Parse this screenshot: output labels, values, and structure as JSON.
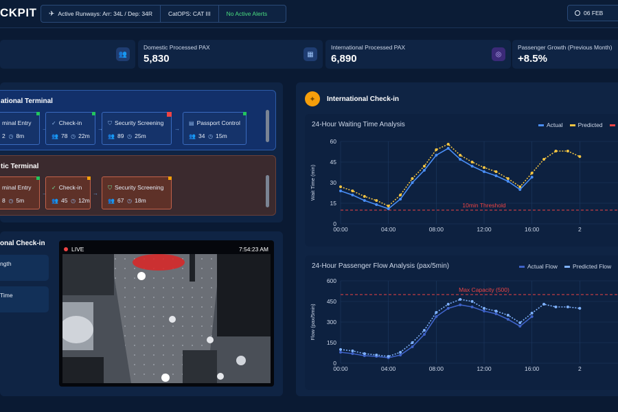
{
  "header": {
    "brand": "CKPIT",
    "runways": "Active Runways: Arr: 34L / Dep: 34R",
    "catops": "CatOPS: CAT III",
    "alerts": "No Active Alerts",
    "date": "06 FEB"
  },
  "kpis": [
    {
      "label": "Domestic Processed PAX",
      "value": "5,830",
      "icon": "users-icon"
    },
    {
      "label": "International Processed PAX",
      "value": "6,890",
      "icon": "map-icon"
    },
    {
      "label": "Passenger Growth (Previous Month)",
      "value": "+8.5%",
      "icon": "globe-icon"
    }
  ],
  "terminals": {
    "international": {
      "title": "ational Terminal",
      "stages": [
        {
          "name": "minal Entry",
          "count": "2",
          "time": "8m",
          "status": "#22c55e"
        },
        {
          "name": "Check-in",
          "count": "78",
          "time": "22m",
          "status": "#22c55e"
        },
        {
          "name": "Security Screening",
          "count": "89",
          "time": "25m",
          "status": "#ef4444"
        },
        {
          "name": "Passport Control",
          "count": "34",
          "time": "15m",
          "status": "#22c55e"
        }
      ]
    },
    "domestic": {
      "title": "tic Terminal",
      "stages": [
        {
          "name": "minal Entry",
          "count": "8",
          "time": "5m",
          "status": "#22c55e"
        },
        {
          "name": "Check-in",
          "count": "45",
          "time": "12m",
          "status": "#f59e0b"
        },
        {
          "name": "Security Screening",
          "count": "67",
          "time": "18m",
          "status": "#f59e0b"
        }
      ]
    }
  },
  "checkin_panel": {
    "title": "onal Check-in",
    "metric1_label": "ngth",
    "metric2_label": "Time",
    "live_label": "LIVE",
    "cam_time": "7:54:23 AM"
  },
  "right_panel": {
    "title": "International Check-in"
  },
  "chart_data": [
    {
      "type": "line",
      "title": "24-Hour Waiting Time Analysis",
      "ylabel": "Wait Time (min)",
      "ylim": [
        0,
        60
      ],
      "yticks": [
        0,
        15,
        30,
        45,
        60
      ],
      "xticks": [
        "00:00",
        "04:00",
        "08:00",
        "12:00",
        "16:00",
        "2"
      ],
      "x": [
        0,
        1,
        2,
        3,
        4,
        5,
        6,
        7,
        8,
        9,
        10,
        11,
        12,
        13,
        14,
        15,
        16,
        17,
        18,
        19,
        20,
        21,
        22
      ],
      "series": [
        {
          "name": "Actual",
          "color": "#4a8ef5",
          "values": [
            24,
            21,
            17,
            14,
            11,
            18,
            30,
            39,
            50,
            55,
            47,
            42,
            38,
            35,
            31,
            25,
            34,
            null,
            null,
            null,
            null,
            null,
            null
          ]
        },
        {
          "name": "Predicted",
          "color": "#f5c542",
          "values": [
            27,
            24,
            20,
            17,
            13,
            21,
            33,
            42,
            54,
            58,
            50,
            45,
            41,
            38,
            33,
            27,
            37,
            47,
            53,
            53,
            49,
            null,
            null
          ]
        }
      ],
      "threshold": {
        "label": "10min Threshold",
        "value": 10
      },
      "legend_extra": "#ef4444"
    },
    {
      "type": "line",
      "title": "24-Hour Passenger Flow Analysis (pax/5min)",
      "ylabel": "Flow (pax/5min)",
      "ylim": [
        0,
        600
      ],
      "yticks": [
        0,
        150,
        300,
        450,
        600
      ],
      "xticks": [
        "00:00",
        "04:00",
        "08:00",
        "12:00",
        "16:00",
        "2"
      ],
      "x": [
        0,
        1,
        2,
        3,
        4,
        5,
        6,
        7,
        8,
        9,
        10,
        11,
        12,
        13,
        14,
        15,
        16,
        17,
        18,
        19,
        20
      ],
      "series": [
        {
          "name": "Actual Flow",
          "color": "#3f63c8",
          "values": [
            80,
            70,
            55,
            50,
            40,
            60,
            120,
            210,
            340,
            400,
            425,
            410,
            380,
            360,
            320,
            270,
            340,
            null,
            null,
            null,
            null
          ]
        },
        {
          "name": "Predicted Flow",
          "color": "#7fb2ff",
          "values": [
            100,
            90,
            70,
            60,
            50,
            80,
            150,
            240,
            370,
            430,
            465,
            450,
            400,
            380,
            350,
            295,
            365,
            430,
            410,
            410,
            400
          ]
        }
      ],
      "threshold": {
        "label": "Max Capacity (500)",
        "value": 500
      }
    }
  ]
}
